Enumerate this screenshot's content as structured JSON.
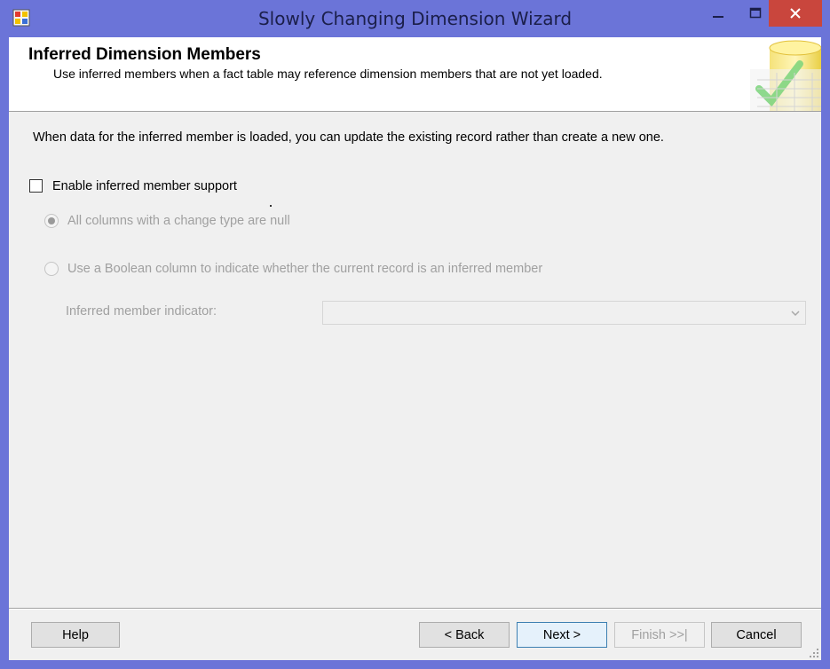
{
  "window": {
    "title": "Slowly Changing Dimension Wizard"
  },
  "header": {
    "title": "Inferred Dimension Members",
    "subtitle": "Use inferred members when a fact table may reference dimension members that are not yet loaded."
  },
  "body": {
    "description": "When data for the inferred member is loaded, you can update the existing record rather than create a new one.",
    "enable_checkbox": {
      "label": "Enable inferred member support",
      "checked": false
    },
    "options": [
      {
        "label": "All columns with a change type are null",
        "selected": true,
        "enabled": false
      },
      {
        "label": "Use a Boolean column to indicate whether the current record is an inferred member",
        "selected": false,
        "enabled": false
      }
    ],
    "indicator": {
      "label": "Inferred member indicator:",
      "value": ""
    }
  },
  "buttons": {
    "help": "Help",
    "back": "< Back",
    "next": "Next >",
    "finish": "Finish >>|",
    "cancel": "Cancel"
  },
  "colors": {
    "frame": "#6b74d8",
    "close": "#c9463d",
    "disabled_text": "#a0a0a0"
  },
  "icons": {
    "app": "wizard-app-icon",
    "header_graphic": "database-checkmark-icon"
  }
}
